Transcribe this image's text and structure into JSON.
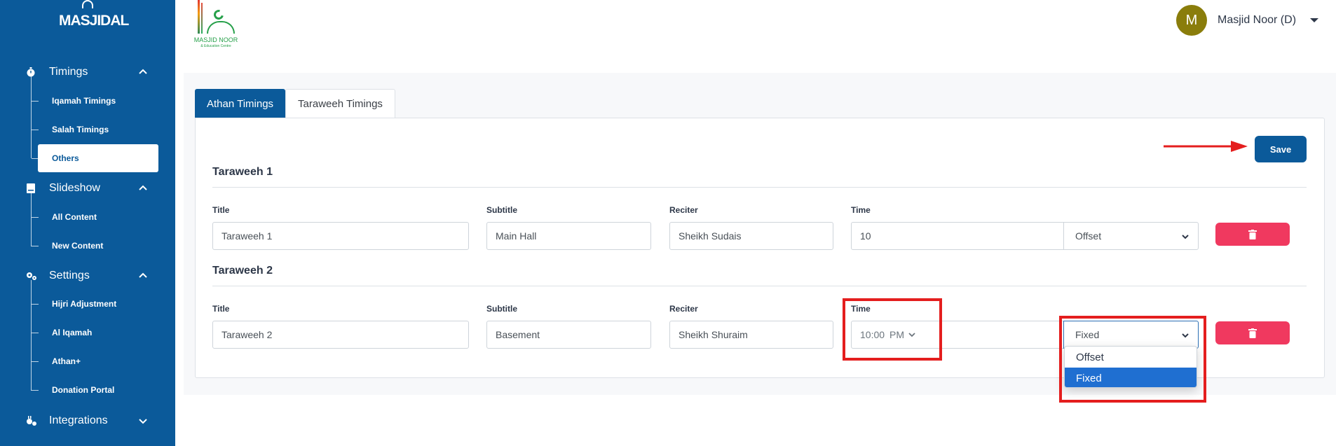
{
  "sidebar": {
    "brand": "MASJIDAL",
    "sections": [
      {
        "label": "Timings",
        "icon": "stopwatch-icon",
        "expanded": true,
        "items": [
          "Iqamah Timings",
          "Salah Timings",
          "Others"
        ]
      },
      {
        "label": "Slideshow",
        "icon": "slides-icon",
        "expanded": true,
        "items": [
          "All Content",
          "New Content"
        ]
      },
      {
        "label": "Settings",
        "icon": "gears-icon",
        "expanded": true,
        "items": [
          "Hijri Adjustment",
          "Al Iqamah",
          "Athan+",
          "Donation Portal"
        ]
      },
      {
        "label": "Integrations",
        "icon": "plug-icon",
        "expanded": false,
        "items": []
      }
    ],
    "active_item": "Others"
  },
  "header": {
    "logo_text": "MASJID NOOR",
    "logo_subtext": "& Education Centre",
    "user": {
      "initial": "M",
      "name": "Masjid Noor (D)"
    }
  },
  "tabs": [
    {
      "label": "Athan Timings",
      "active": true
    },
    {
      "label": "Taraweeh Timings",
      "active": false
    }
  ],
  "save_label": "Save",
  "labels": {
    "title": "Title",
    "subtitle": "Subtitle",
    "reciter": "Reciter",
    "time": "Time"
  },
  "taraweeh": [
    {
      "heading": "Taraweeh 1",
      "title": "Taraweeh 1",
      "subtitle": "Main Hall",
      "reciter": "Sheikh Sudais",
      "time_value": "10",
      "mode": "Offset"
    },
    {
      "heading": "Taraweeh 2",
      "title": "Taraweeh 2",
      "subtitle": "Basement",
      "reciter": "Sheikh Shuraim",
      "time_hour": "10",
      "time_minute": "00",
      "time_ampm": "PM",
      "time_sep": ":",
      "mode": "Fixed"
    }
  ],
  "mode_options": [
    "Offset",
    "Fixed"
  ],
  "dropdown_selected": "Fixed",
  "colors": {
    "sidebar": "#0b5a9a",
    "accent": "#0b5a9a",
    "delete": "#f0395f",
    "highlight": "#e41e1e",
    "avatar": "#8a7d0b"
  }
}
